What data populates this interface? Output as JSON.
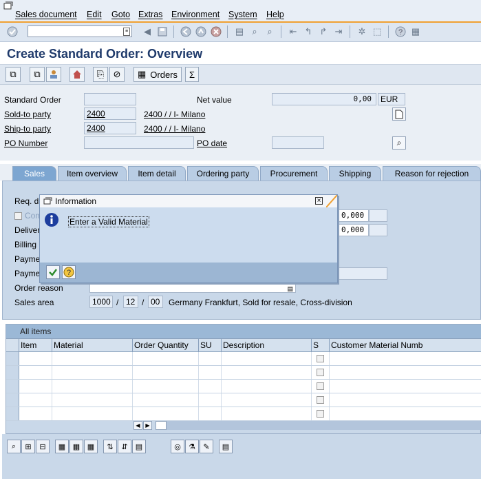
{
  "menu": {
    "items": [
      "Sales document",
      "Edit",
      "Goto",
      "Extras",
      "Environment",
      "System",
      "Help"
    ]
  },
  "page": {
    "title": "Create Standard Order: Overview"
  },
  "toolbar": {
    "orders_label": "Orders"
  },
  "header": {
    "standard_order_label": "Standard Order",
    "standard_order_value": "",
    "net_value_label": "Net value",
    "net_value": "0,00",
    "currency": "EUR",
    "sold_to_label": "Sold-to party",
    "sold_to_value": "2400",
    "sold_to_desc": "2400 / / I- Milano",
    "ship_to_label": "Ship-to party",
    "ship_to_value": "2400",
    "ship_to_desc": "2400 / / I- Milano",
    "po_number_label": "PO Number",
    "po_date_label": "PO date"
  },
  "tabs": [
    {
      "label": "Sales",
      "active": true
    },
    {
      "label": "Item overview"
    },
    {
      "label": "Item detail"
    },
    {
      "label": "Ordering party"
    },
    {
      "label": "Procurement"
    },
    {
      "label": "Shipping"
    },
    {
      "label": "Reason for rejection"
    }
  ],
  "sales_tab": {
    "req_label": "Req. d",
    "complete_label": "Com",
    "delivery_label": "Deliver",
    "billing_label": "Billing",
    "payment1_label": "Payme",
    "payment2_label": "Payme",
    "order_reason_label": "Order reason",
    "sales_area_label": "Sales area",
    "sales_org": "1000",
    "distr_channel": "12",
    "division": "00",
    "sales_area_desc": "Germany Frankfurt, Sold for resale, Cross-division",
    "weight_value": "0,000",
    "volume_value": "0,000",
    "slash": "/"
  },
  "items_table": {
    "title": "All items",
    "columns": [
      "Item",
      "Material",
      "Order Quantity",
      "SU",
      "Description",
      "S",
      "Customer Material Numb"
    ],
    "row_count": 5
  },
  "dialog": {
    "title": "Information",
    "message": "Enter a Valid Material",
    "close_glyph": "×"
  },
  "colors": {
    "accent": "#f0a030",
    "title": "#1f3a6b",
    "tab_active": "#7da6d1",
    "tab": "#b9cde4",
    "info_icon": "#1d3e9e"
  },
  "icons": [
    "check-icon",
    "save-icon",
    "back-icon",
    "exit-icon",
    "cancel-icon",
    "print-icon",
    "find-icon",
    "help-icon",
    "info-icon",
    "confirm-icon"
  ]
}
